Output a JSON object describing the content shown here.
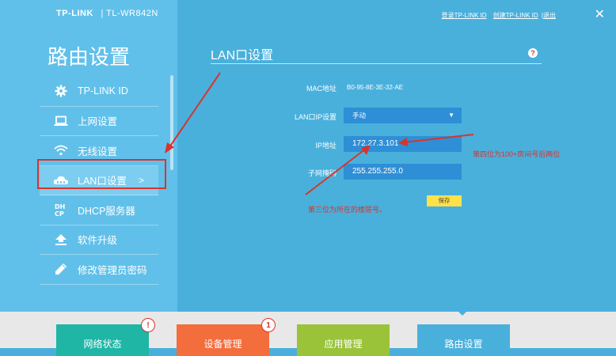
{
  "header": {
    "brand": "TP-LINK",
    "model": "TL-WR842N",
    "links": [
      "登录TP-LINK ID",
      "创建TP-LINK ID",
      "退出"
    ],
    "close_symbol": "✕"
  },
  "sidebar": {
    "title": "路由设置",
    "items": [
      {
        "label": "TP-LINK ID",
        "icon": "gear-icon"
      },
      {
        "label": "上网设置",
        "icon": "laptop-icon"
      },
      {
        "label": "无线设置",
        "icon": "wifi-icon"
      },
      {
        "label": "LAN口设置",
        "icon": "cloud-network-icon",
        "active": true,
        "chevron": ">"
      },
      {
        "label": "DHCP服务器",
        "icon": "dhcp-icon"
      },
      {
        "label": "软件升级",
        "icon": "upload-icon"
      },
      {
        "label": "修改管理员密码",
        "icon": "pencil-icon"
      }
    ]
  },
  "main": {
    "section_title": "LAN口设置",
    "help_symbol": "?",
    "fields": {
      "mac_label": "MAC地址",
      "mac_value": "B0-95-8E-3E-32-AE",
      "lan_ip_mode_label": "LAN口IP设置",
      "lan_ip_mode_value": "手动",
      "ip_label": "IP地址",
      "ip_value": "172.27.3.101",
      "mask_label": "子网掩码",
      "mask_value": "255.255.255.0"
    },
    "save_label": "保存"
  },
  "annotations": {
    "fourth_octet_note": "第四位为100+房间号后两位",
    "third_octet_note": "第三位为所在的楼层号。"
  },
  "bottom_tabs": [
    {
      "label": "网络状态",
      "badge": "!",
      "color": "#1fb6a6"
    },
    {
      "label": "设备管理",
      "badge": "1",
      "color": "#f36d3d"
    },
    {
      "label": "应用管理",
      "badge": "",
      "color": "#9ac33a"
    },
    {
      "label": "路由设置",
      "badge": "",
      "color": "#49b0dc"
    }
  ],
  "colors": {
    "accent_red": "#d9342b",
    "save_yellow": "#ffe24a",
    "input_blue": "#2e8fd7"
  }
}
